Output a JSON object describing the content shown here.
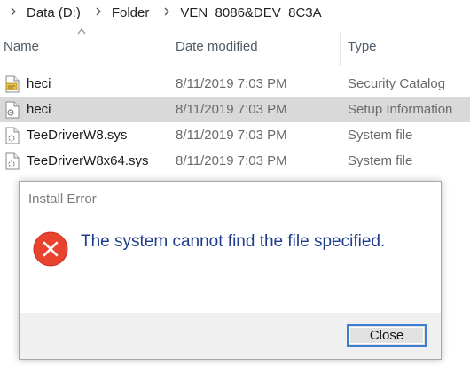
{
  "breadcrumb": {
    "items": [
      {
        "label": "Data (D:)"
      },
      {
        "label": "Folder"
      },
      {
        "label": "VEN_8086&DEV_8C3A"
      }
    ]
  },
  "columns": {
    "name": "Name",
    "date_modified": "Date modified",
    "type": "Type",
    "sort_indicator": "ascending-on-name"
  },
  "files": [
    {
      "name": "heci",
      "date": "8/11/2019 7:03 PM",
      "type": "Security Catalog",
      "icon": "security-catalog-icon",
      "selected": false
    },
    {
      "name": "heci",
      "date": "8/11/2019 7:03 PM",
      "type": "Setup Information",
      "icon": "setup-information-icon",
      "selected": true
    },
    {
      "name": "TeeDriverW8.sys",
      "date": "8/11/2019 7:03 PM",
      "type": "System file",
      "icon": "system-file-icon",
      "selected": false
    },
    {
      "name": "TeeDriverW8x64.sys",
      "date": "8/11/2019 7:03 PM",
      "type": "System file",
      "icon": "system-file-icon",
      "selected": false
    }
  ],
  "dialog": {
    "title": "Install Error",
    "message": "The system cannot find the file specified.",
    "icon": "error-icon",
    "close_label": "Close"
  },
  "colors": {
    "selected_row": "#d9d9d9",
    "message_text": "#1d3c8c",
    "error_red": "#e8432f",
    "button_focus": "#3c7fd1"
  }
}
